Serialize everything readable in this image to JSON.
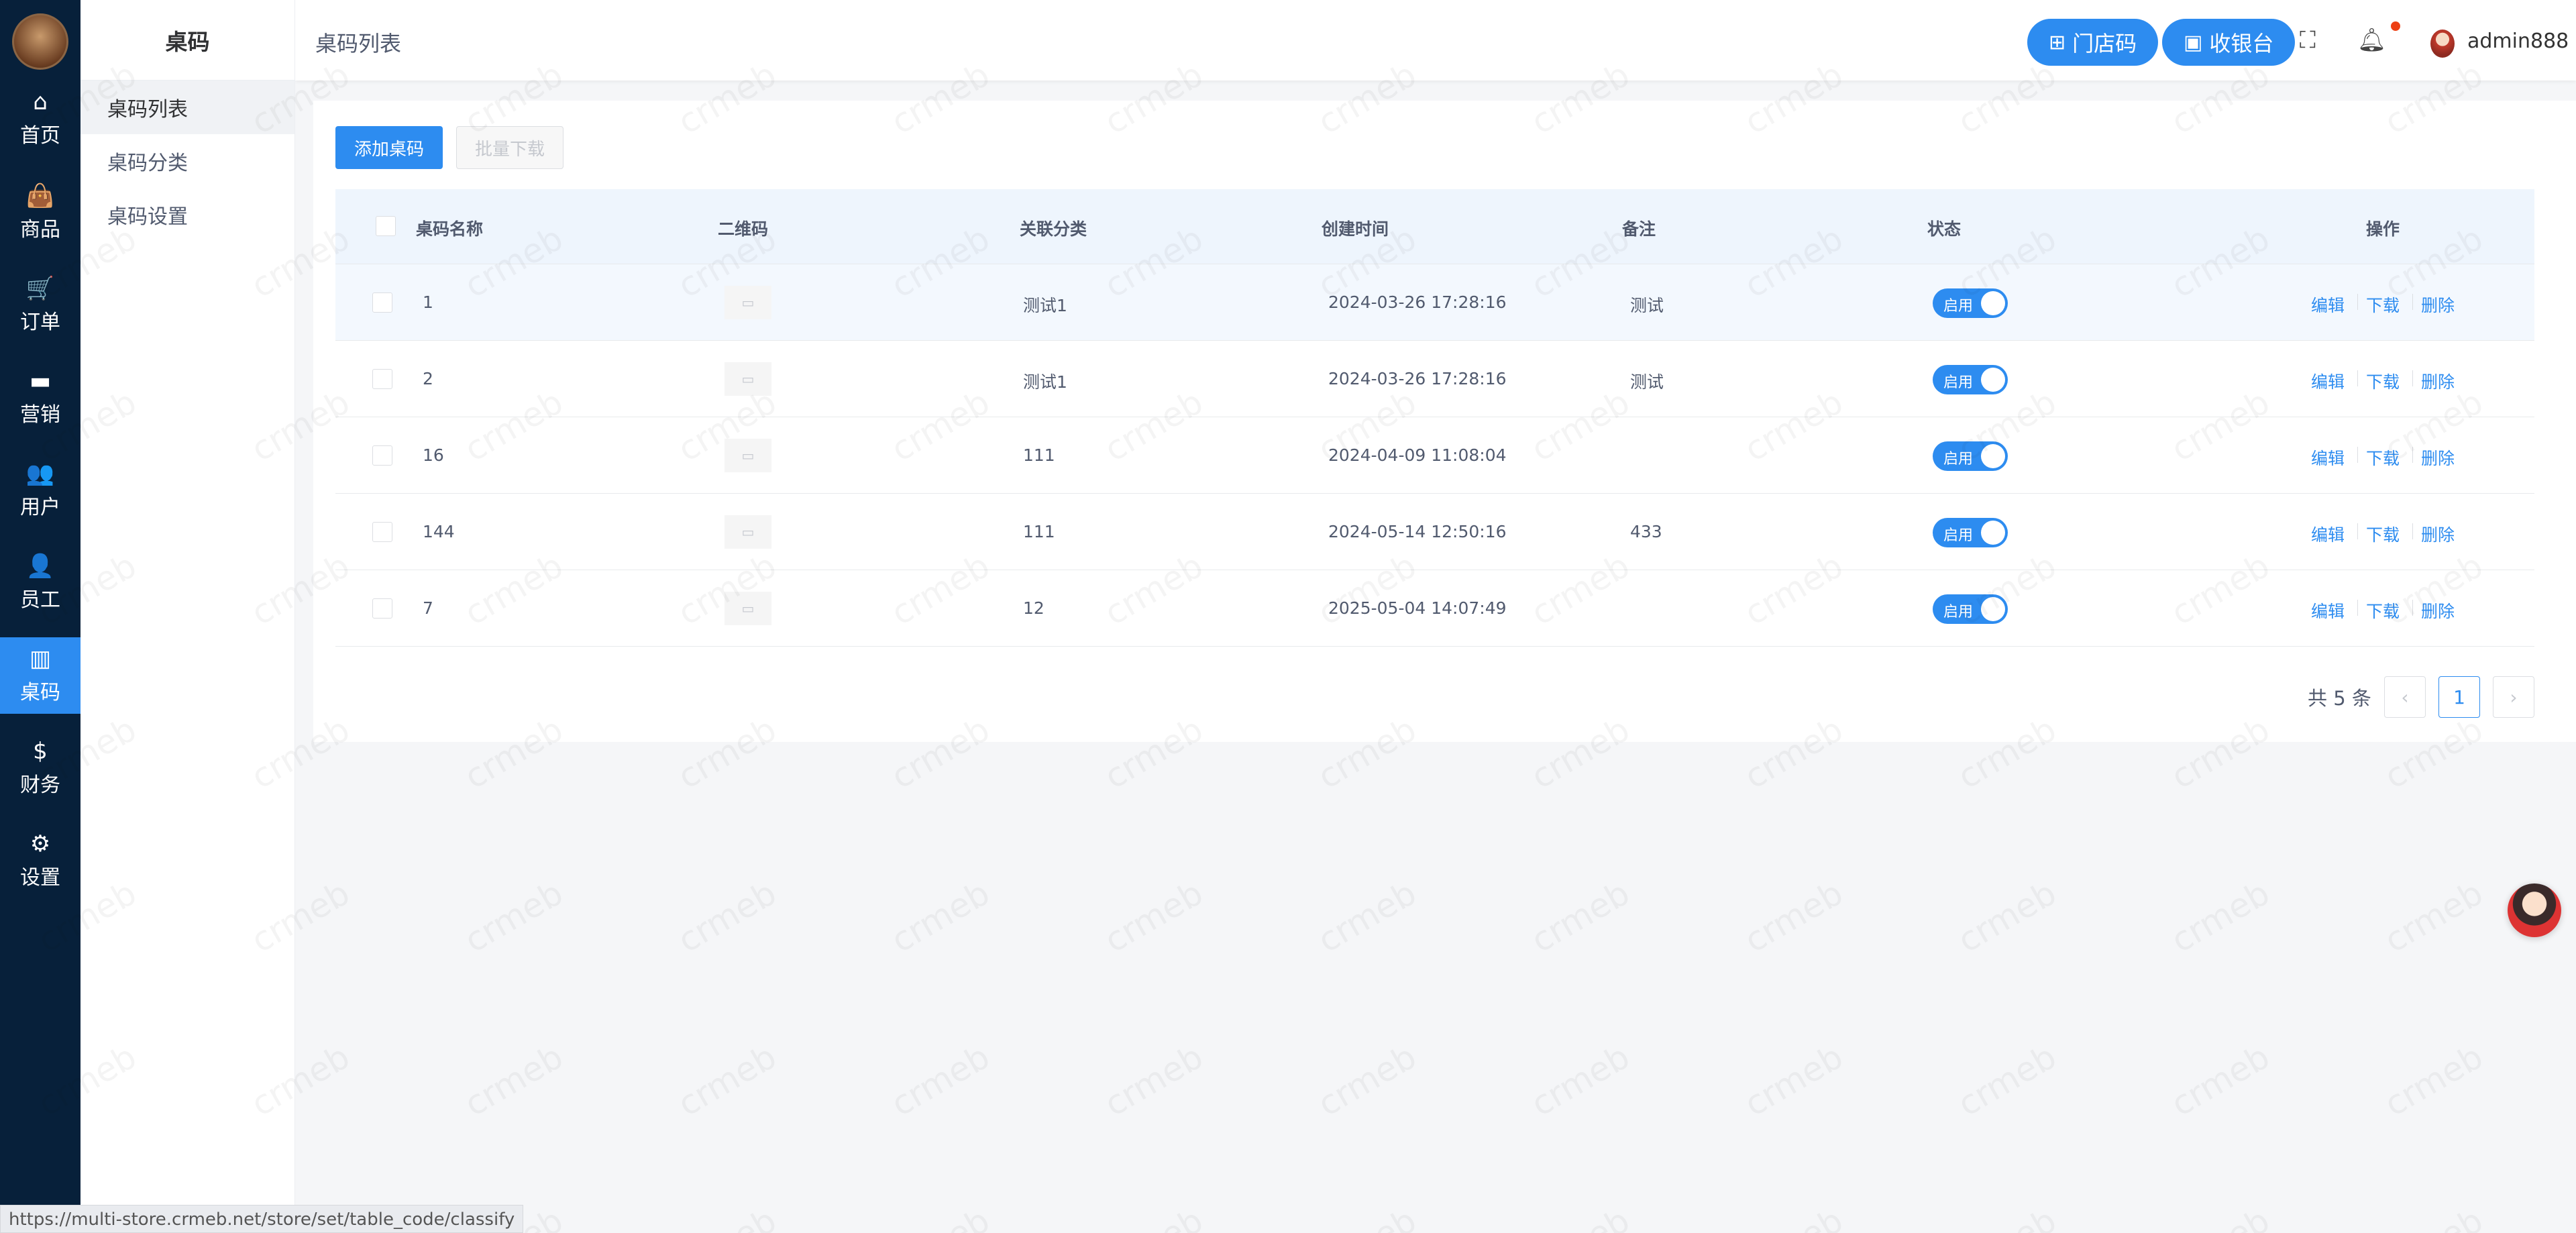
{
  "nav": {
    "items": [
      {
        "icon": "⌂",
        "label": "首页",
        "icon_name": "home-icon"
      },
      {
        "icon": "👜",
        "label": "商品",
        "icon_name": "shopping-bag-icon"
      },
      {
        "icon": "🛒",
        "label": "订单",
        "icon_name": "cart-icon"
      },
      {
        "icon": "▬",
        "label": "营销",
        "icon_name": "briefcase-icon"
      },
      {
        "icon": "👥",
        "label": "用户",
        "icon_name": "users-icon"
      },
      {
        "icon": "👤",
        "label": "员工",
        "icon_name": "staff-icon"
      },
      {
        "icon": "▥",
        "label": "桌码",
        "icon_name": "table-code-icon"
      },
      {
        "icon": "$",
        "label": "财务",
        "icon_name": "dollar-icon"
      },
      {
        "icon": "⚙",
        "label": "设置",
        "icon_name": "gear-icon"
      }
    ]
  },
  "subnav": {
    "title": "桌码",
    "items": [
      "桌码列表",
      "桌码分类",
      "桌码设置"
    ]
  },
  "header": {
    "breadcrumb": "桌码列表",
    "store_code_btn": "门店码",
    "cashier_btn": "收银台",
    "username": "admin888"
  },
  "toolbar": {
    "add_label": "添加桌码",
    "batch_download_label": "批量下载"
  },
  "table": {
    "columns": [
      "桌码名称",
      "二维码",
      "关联分类",
      "创建时间",
      "备注",
      "状态",
      "操作"
    ],
    "rows": [
      {
        "name": "1",
        "category": "测试1",
        "created": "2024-03-26 17:28:16",
        "remark": "测试",
        "status": "启用"
      },
      {
        "name": "2",
        "category": "测试1",
        "created": "2024-03-26 17:28:16",
        "remark": "测试",
        "status": "启用"
      },
      {
        "name": "16",
        "category": "111",
        "created": "2024-04-09 11:08:04",
        "remark": "",
        "status": "启用"
      },
      {
        "name": "144",
        "category": "111",
        "created": "2024-05-14 12:50:16",
        "remark": "433",
        "status": "启用"
      },
      {
        "name": "7",
        "category": "12",
        "created": "2025-05-04 14:07:49",
        "remark": "",
        "status": "启用"
      }
    ],
    "actions": {
      "edit": "编辑",
      "download": "下载",
      "delete": "删除"
    }
  },
  "pagination": {
    "total": "共 5 条",
    "current": "1",
    "prev": "‹",
    "next": "›"
  },
  "status_bar_url": "https://multi-store.crmeb.net/store/set/table_code/classify",
  "colors": {
    "primary": "#2d8cf0",
    "nav_bg": "#07203a",
    "danger_dot": "#ed4014"
  }
}
